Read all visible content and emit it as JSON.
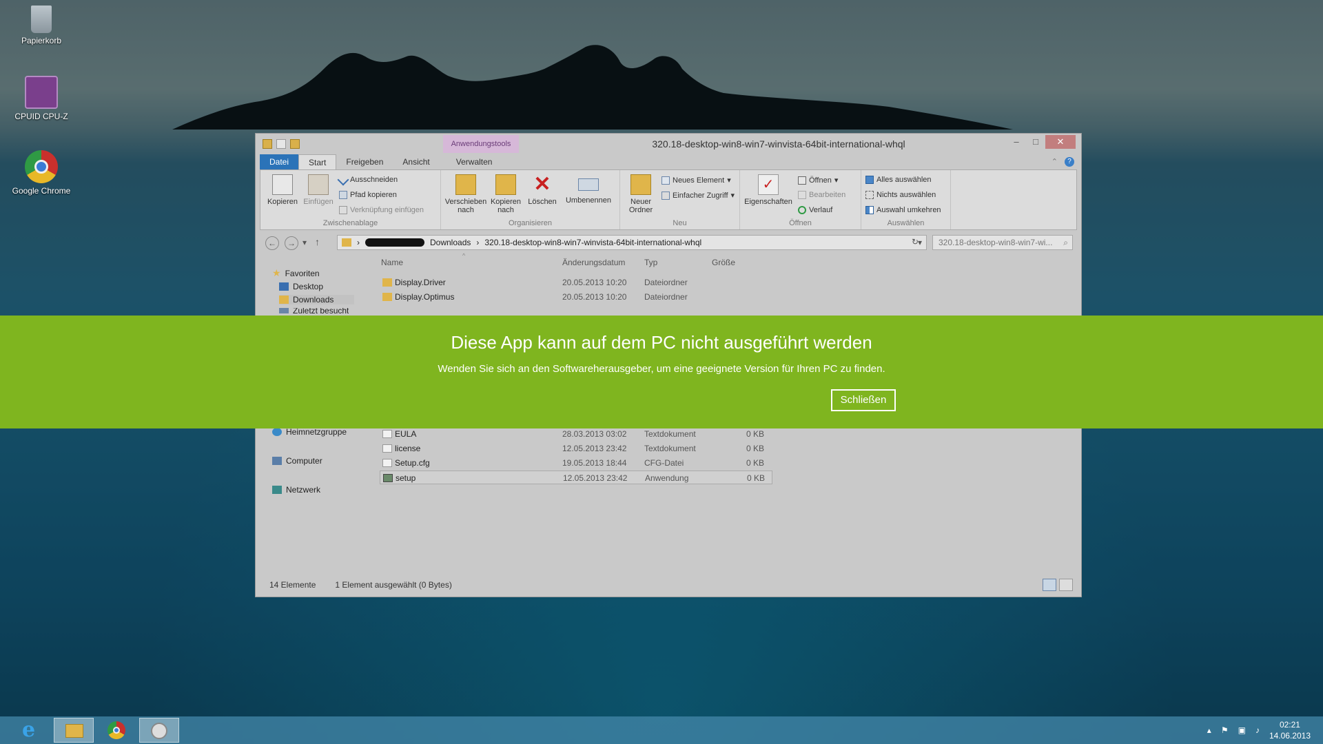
{
  "desktop": {
    "icons": [
      {
        "label": "Papierkorb",
        "icon": "recycle-bin-icon"
      },
      {
        "label": "CPUID CPU-Z",
        "icon": "cpuz-icon"
      },
      {
        "label": "Google Chrome",
        "icon": "chrome-icon"
      }
    ]
  },
  "window": {
    "title": "320.18-desktop-win8-win7-winvista-64bit-international-whql",
    "context_tab": "Anwendungstools",
    "tabs": {
      "file": "Datei",
      "start": "Start",
      "share": "Freigeben",
      "view": "Ansicht",
      "manage": "Verwalten"
    },
    "ribbon": {
      "clipboard": {
        "label": "Zwischenablage",
        "copy": "Kopieren",
        "paste": "Einfügen",
        "cut": "Ausschneiden",
        "copy_path": "Pfad kopieren",
        "paste_shortcut": "Verknüpfung einfügen"
      },
      "organize": {
        "label": "Organisieren",
        "move_to": "Verschieben nach",
        "copy_to": "Kopieren nach",
        "delete": "Löschen",
        "rename": "Umbenennen"
      },
      "new": {
        "label": "Neu",
        "new_folder": "Neuer Ordner",
        "new_item": "Neues Element",
        "easy_access": "Einfacher Zugriff"
      },
      "open": {
        "label": "Öffnen",
        "properties": "Eigenschaften",
        "open": "Öffnen",
        "edit": "Bearbeiten",
        "history": "Verlauf"
      },
      "select": {
        "label": "Auswählen",
        "select_all": "Alles auswählen",
        "select_none": "Nichts auswählen",
        "invert": "Auswahl umkehren"
      }
    },
    "address": {
      "segments": [
        "Downloads",
        "320.18-desktop-win8-win7-winvista-64bit-international-whql"
      ],
      "search_placeholder": "320.18-desktop-win8-win7-wi..."
    },
    "nav_pane": {
      "favorites": "Favoriten",
      "desktop": "Desktop",
      "downloads": "Downloads",
      "recent": "Zuletzt besucht",
      "homegroup": "Heimnetzgruppe",
      "computer": "Computer",
      "network": "Netzwerk"
    },
    "columns": {
      "name": "Name",
      "date": "Änderungsdatum",
      "type": "Typ",
      "size": "Größe"
    },
    "files_top": [
      {
        "name": "Display.Driver",
        "date": "20.05.2013 10:20",
        "type": "Dateiordner",
        "size": ""
      },
      {
        "name": "Display.Optimus",
        "date": "20.05.2013 10:20",
        "type": "Dateiordner",
        "size": ""
      }
    ],
    "files_bottom": [
      {
        "name": "EULA",
        "date": "28.03.2013 03:02",
        "type": "Textdokument",
        "size": "0 KB"
      },
      {
        "name": "license",
        "date": "12.05.2013 23:42",
        "type": "Textdokument",
        "size": "0 KB"
      },
      {
        "name": "Setup.cfg",
        "date": "19.05.2013 18:44",
        "type": "CFG-Datei",
        "size": "0 KB"
      },
      {
        "name": "setup",
        "date": "12.05.2013 23:42",
        "type": "Anwendung",
        "size": "0 KB"
      }
    ],
    "status": {
      "count": "14 Elemente",
      "selection": "1 Element ausgewählt (0 Bytes)"
    }
  },
  "overlay": {
    "title": "Diese App kann auf dem PC nicht ausgeführt werden",
    "message": "Wenden Sie sich an den Softwareherausgeber, um eine geeignete Version für Ihren PC zu finden.",
    "close_button": "Schließen",
    "color": "#7fb51f"
  },
  "taskbar": {
    "time": "02:21",
    "date": "14.06.2013"
  }
}
